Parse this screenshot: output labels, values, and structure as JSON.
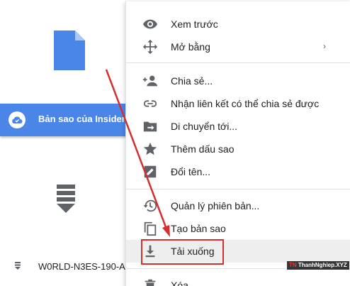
{
  "background": {
    "selected_file_name": "Bản sao của Insider.",
    "bottom_file_name": "W0RLD-N3ES-190-A..."
  },
  "context_menu": {
    "items": [
      {
        "label": "Xem trước",
        "icon": "eye-icon"
      },
      {
        "label": "Mở bằng",
        "icon": "move-icon",
        "has_submenu": true,
        "submenu_arrow": "›"
      },
      {
        "label": "Chia sẻ...",
        "icon": "person-add-icon"
      },
      {
        "label": "Nhận liên kết có thể chia sẻ được",
        "icon": "link-icon"
      },
      {
        "label": "Di chuyển tới...",
        "icon": "folder-move-icon"
      },
      {
        "label": "Thêm dấu sao",
        "icon": "star-icon"
      },
      {
        "label": "Đổi tên...",
        "icon": "pencil-icon"
      },
      {
        "label": "Quản lý phiên bản...",
        "icon": "history-icon"
      },
      {
        "label": "Tạo bản sao",
        "icon": "copy-icon"
      },
      {
        "label": "Tải xuống",
        "icon": "download-icon",
        "highlighted": true
      },
      {
        "label": "Xóa",
        "icon": "trash-icon"
      }
    ]
  },
  "annotation": {
    "color": "#d32f2f"
  },
  "watermark": {
    "prefix": "TN",
    "text": "ThanhNghiep.XYZ"
  },
  "colors": {
    "accent_blue": "#4a86e8",
    "icon_gray": "#5f6368",
    "highlight": "#eeeeee"
  }
}
